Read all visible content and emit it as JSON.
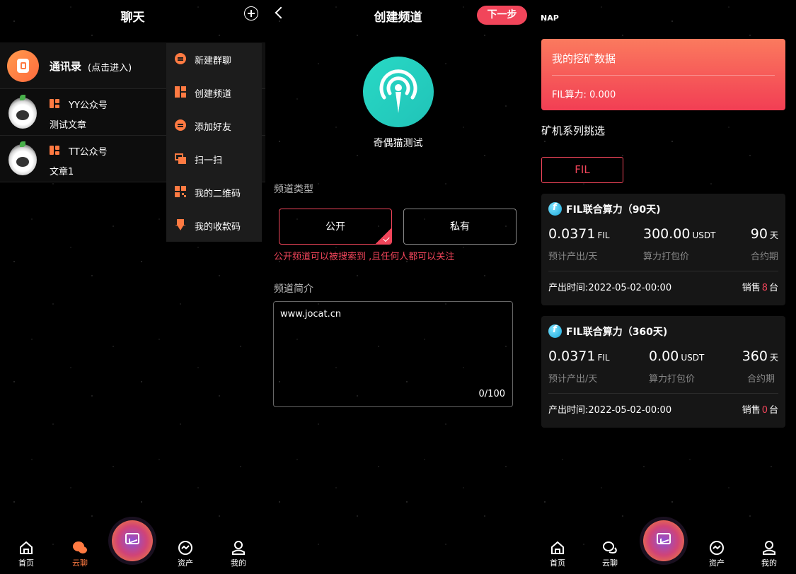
{
  "chat_panel": {
    "title": "聊天",
    "contacts": {
      "title": "通讯录",
      "subtitle": "(点击进入)"
    },
    "accounts": [
      {
        "name": "YY公众号",
        "article": "测试文章"
      },
      {
        "name": "TT公众号",
        "article": "文章1"
      }
    ],
    "menu": [
      {
        "label": "新建群聊",
        "icon": "chat-bubble-icon"
      },
      {
        "label": "创建频道",
        "icon": "grid-icon"
      },
      {
        "label": "添加好友",
        "icon": "chat-bubble-icon"
      },
      {
        "label": "扫一扫",
        "icon": "scan-icon"
      },
      {
        "label": "我的二维码",
        "icon": "qr-code-icon"
      },
      {
        "label": "我的收款码",
        "icon": "download-shield-icon"
      }
    ]
  },
  "tabbar_left": {
    "home": "首页",
    "chat": "云聊",
    "assets": "资产",
    "mine": "我的",
    "active": "云聊"
  },
  "create_channel": {
    "title": "创建频道",
    "next_label": "下一步",
    "channel_name": "奇偶猫测试",
    "type_label": "频道类型",
    "public_label": "公开",
    "private_label": "私有",
    "selected_type": "公开",
    "hint": "公开频道可以被搜索到 ,且任何人都可以关注",
    "intro_label": "频道简介",
    "intro_value": "www.jocat.cn",
    "counter_current": "0",
    "counter_max": "/100"
  },
  "mining": {
    "brand": "NAP",
    "card_title": "我的挖矿数据",
    "power": "FIL算力: 0.000",
    "series_title": "矿机系列挑选",
    "filter_chip": "FIL",
    "products": [
      {
        "name": "FIL联合算力（90天)",
        "output_value": "0.0371",
        "output_unit": "FIL",
        "output_label": "预计产出/天",
        "price_value": "300.00",
        "price_unit": "USDT",
        "price_label": "算力打包价",
        "term_value": "90",
        "term_unit": "天",
        "term_label": "合约期",
        "time": "产出时间:2022-05-02-00:00",
        "sold_prefix": "销售",
        "sold_count": "8",
        "sold_suffix": "台"
      },
      {
        "name": "FIL联合算力（360天)",
        "output_value": "0.0371",
        "output_unit": "FIL",
        "output_label": "预计产出/天",
        "price_value": "0.00",
        "price_unit": "USDT",
        "price_label": "算力打包价",
        "term_value": "360",
        "term_unit": "天",
        "term_label": "合约期",
        "time": "产出时间:2022-05-02-00:00",
        "sold_prefix": "销售",
        "sold_count": "0",
        "sold_suffix": "台"
      }
    ]
  },
  "tabbar_right": {
    "home": "首页",
    "chat": "云聊",
    "assets": "资产",
    "mine": "我的"
  },
  "colors": {
    "accent": "#f1455a",
    "orange": "#ff7a42",
    "teal": "#28d9c5"
  }
}
